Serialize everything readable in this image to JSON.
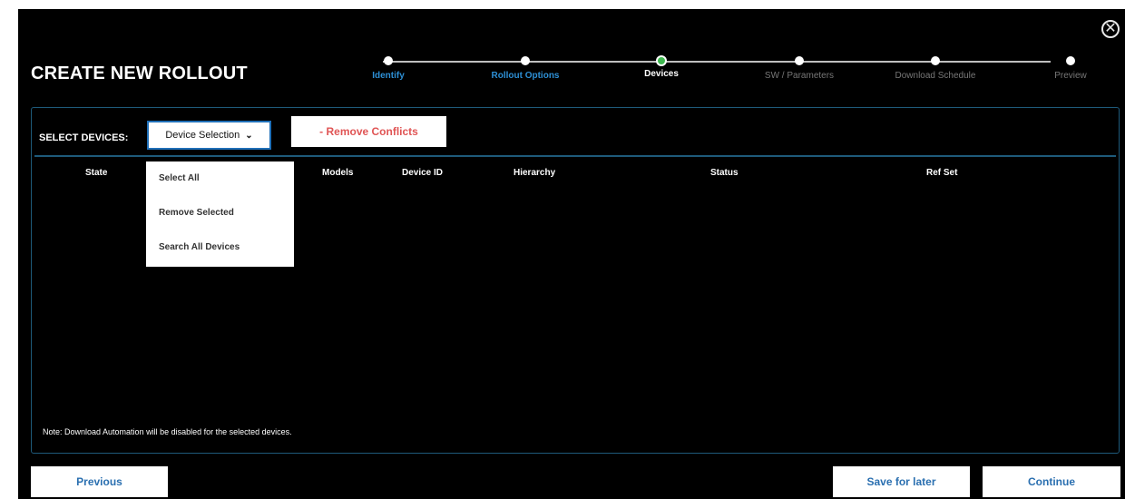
{
  "title": "CREATE NEW ROLLOUT",
  "close_icon_glyph": "✕",
  "steps": [
    {
      "label": "Identify",
      "state": "done"
    },
    {
      "label": "Rollout Options",
      "state": "done"
    },
    {
      "label": "Devices",
      "state": "current"
    },
    {
      "label": "SW / Parameters",
      "state": "future"
    },
    {
      "label": "Download Schedule",
      "state": "future"
    },
    {
      "label": "Preview",
      "state": "future"
    }
  ],
  "select_devices_label": "SELECT DEVICES:",
  "device_selection": {
    "label": "Device Selection",
    "options": [
      "Select All",
      "Remove Selected",
      "Search All Devices"
    ]
  },
  "remove_conflicts_label": "- Remove Conflicts",
  "table_headers": {
    "state": "State",
    "models": "Models",
    "device_id": "Device ID",
    "hierarchy": "Hierarchy",
    "status": "Status",
    "ref_set": "Ref Set"
  },
  "note": "Note: Download Automation will be disabled for the selected devices.",
  "footer": {
    "previous": "Previous",
    "save_for_later": "Save for later",
    "continue": "Continue"
  },
  "colors": {
    "accent_blue": "#2d8fd5",
    "active_step": "#3fb950",
    "danger": "#e05555",
    "panel_border": "#1e5a7a"
  }
}
